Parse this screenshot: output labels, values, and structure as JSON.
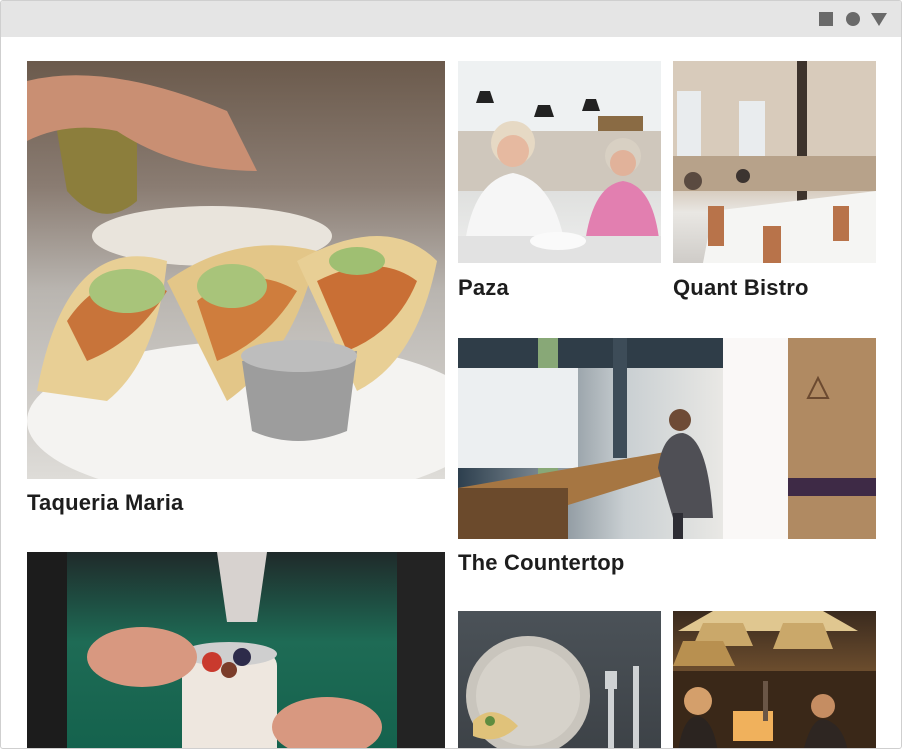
{
  "window": {
    "controls": [
      "square-icon",
      "circle-icon",
      "triangle-down-icon"
    ]
  },
  "restaurants": [
    {
      "name": "Taqueria Maria",
      "image": "tacos-photo"
    },
    {
      "name": "",
      "image": "yogurt-parfait-photo"
    },
    {
      "name": "Paza",
      "image": "diners-photo"
    },
    {
      "name": "Quant Bistro",
      "image": "bistro-interior-photo"
    },
    {
      "name": "The Countertop",
      "image": "counter-diner-photo"
    },
    {
      "name": "",
      "image": "plate-cutlery-photo"
    },
    {
      "name": "",
      "image": "bar-lamps-photo"
    }
  ],
  "colors": {
    "topbar": "#e5e5e5",
    "controls": "#6a6a6a",
    "label_text": "#1d1d1d",
    "background": "#ffffff"
  }
}
